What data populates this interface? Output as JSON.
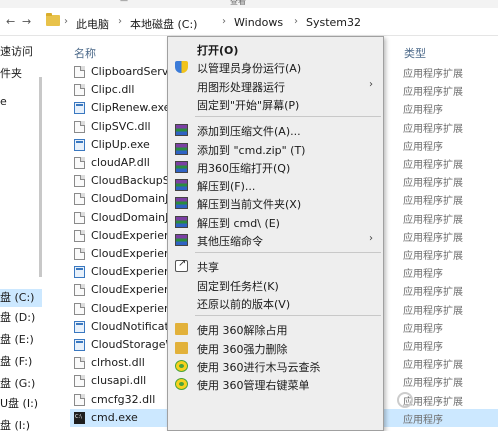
{
  "top_strip": {
    "partial_label_1": "—",
    "partial_label_2": "查看"
  },
  "address_bar": {
    "back": "←",
    "forward": "→",
    "crumbs": [
      "此电脑",
      "本地磁盘 (C:)",
      "Windows",
      "System32"
    ],
    "separator": "›"
  },
  "nav_pane": {
    "items": [
      "速访问",
      "件夹",
      "e",
      "盘 (C:)",
      "盘 (D:)",
      "盘 (E:)",
      "盘 (F:)",
      "盘 (G:)",
      "U盘 (I:)",
      "盘 (I:)"
    ],
    "selected_index": 3
  },
  "columns": {
    "name": "名称",
    "type": "类型"
  },
  "files": [
    {
      "name": "ClipboardServer.dll",
      "type": "应用程序扩展",
      "icon": "dll"
    },
    {
      "name": "Clipc.dll",
      "type": "应用程序扩展",
      "icon": "dll"
    },
    {
      "name": "ClipRenew.exe",
      "type": "应用程序",
      "icon": "exe"
    },
    {
      "name": "ClipSVC.dll",
      "type": "应用程序扩展",
      "icon": "dll"
    },
    {
      "name": "ClipUp.exe",
      "type": "应用程序",
      "icon": "exe"
    },
    {
      "name": "cloudAP.dll",
      "type": "应用程序扩展",
      "icon": "dll"
    },
    {
      "name": "CloudBackupSettings.dll",
      "type": "应用程序扩展",
      "icon": "dll"
    },
    {
      "name": "CloudDomainJoinAUG.dll",
      "type": "应用程序扩展",
      "icon": "dll"
    },
    {
      "name": "CloudDomainJoinDataModelServer.dll",
      "type": "应用程序扩展",
      "icon": "dll"
    },
    {
      "name": "CloudExperienceHost.dll",
      "type": "应用程序扩展",
      "icon": "dll"
    },
    {
      "name": "CloudExperienceHostBroker.dll",
      "type": "应用程序扩展",
      "icon": "dll"
    },
    {
      "name": "CloudExperienceHostBroker.exe",
      "type": "应用程序",
      "icon": "exe"
    },
    {
      "name": "CloudExperienceHostCommon.dll",
      "type": "应用程序扩展",
      "icon": "dll"
    },
    {
      "name": "CloudExperienceHostUser.dll",
      "type": "应用程序扩展",
      "icon": "dll"
    },
    {
      "name": "CloudNotifications.exe",
      "type": "应用程序",
      "icon": "exe"
    },
    {
      "name": "CloudStorageWizard.exe",
      "type": "应用程序",
      "icon": "exe"
    },
    {
      "name": "clrhost.dll",
      "type": "应用程序扩展",
      "icon": "dll"
    },
    {
      "name": "clusapi.dll",
      "type": "应用程序扩展",
      "icon": "dll"
    },
    {
      "name": "cmcfg32.dll",
      "type": "应用程序扩展",
      "icon": "dll"
    },
    {
      "name": "cmd.exe",
      "type": "应用程序",
      "icon": "cmd"
    }
  ],
  "selected_file_index": 19,
  "context_menu": {
    "items": [
      {
        "label": "打开(O)",
        "bold": true,
        "icon": "none"
      },
      {
        "label": "以管理员身份运行(A)",
        "icon": "uac-shield-icon"
      },
      {
        "label": "用图形处理器运行",
        "icon": "none",
        "submenu": true
      },
      {
        "label": "固定到\"开始\"屏幕(P)",
        "icon": "none"
      },
      {
        "sep": true
      },
      {
        "label": "添加到压缩文件(A)...",
        "icon": "winrar-icon"
      },
      {
        "label": "添加到 \"cmd.zip\" (T)",
        "icon": "winrar-icon"
      },
      {
        "label": "用360压缩打开(Q)",
        "icon": "winrar-icon"
      },
      {
        "label": "解压到(F)...",
        "icon": "winrar-icon"
      },
      {
        "label": "解压到当前文件夹(X)",
        "icon": "winrar-icon"
      },
      {
        "label": "解压到 cmd\\ (E)",
        "icon": "winrar-icon"
      },
      {
        "label": "其他压缩命令",
        "icon": "winrar-icon",
        "submenu": true
      },
      {
        "sep": true
      },
      {
        "label": "共享",
        "icon": "share-icon"
      },
      {
        "label": "固定到任务栏(K)",
        "icon": "none"
      },
      {
        "label": "还原以前的版本(V)",
        "icon": "none"
      },
      {
        "sep": true
      },
      {
        "label": "使用 360解除占用",
        "icon": "folder-360-icon"
      },
      {
        "label": "使用 360强力删除",
        "icon": "folder-360-icon"
      },
      {
        "label": "使用 360进行木马云查杀",
        "icon": "360-security-icon"
      },
      {
        "label": "使用 360管理右键菜单",
        "icon": "360-security-icon"
      }
    ],
    "submenu_arrow": "›"
  },
  "colors": {
    "selection": "#cce8ff",
    "menu_bg": "#eeeeee",
    "header_text": "#4d6a8a"
  }
}
